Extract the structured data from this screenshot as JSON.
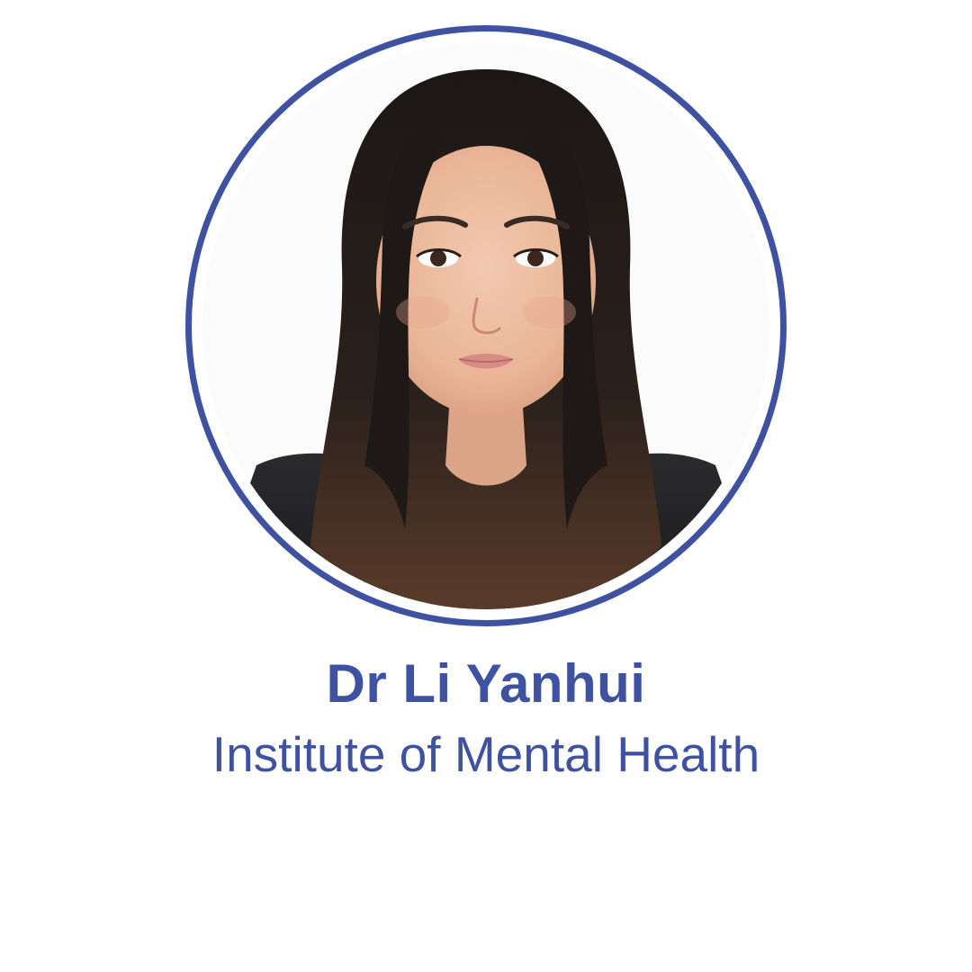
{
  "profile": {
    "name": "Dr Li Yanhui",
    "affiliation": "Institute of Mental Health",
    "photo": "headshot-photo"
  },
  "colors": {
    "accent": "#3e52a1",
    "background": "#ffffff"
  }
}
